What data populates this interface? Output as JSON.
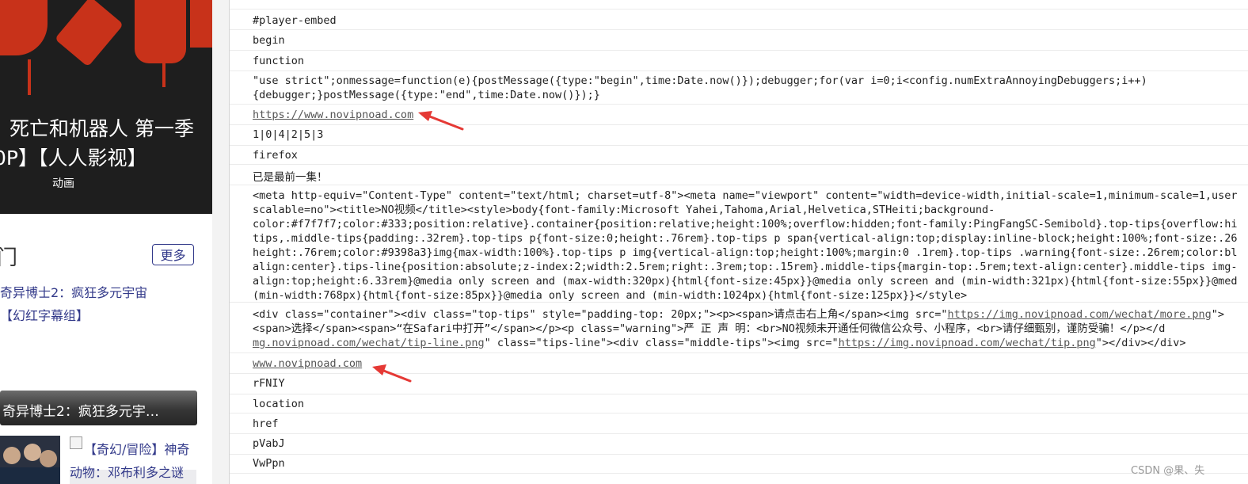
{
  "left_panel": {
    "poster": {
      "title_line1": "死亡和机器人 第一季",
      "title_line2": "0P】【人人影视】",
      "category": "动画"
    },
    "hot_section": {
      "title": "门",
      "more_label": "更多",
      "links": [
        "奇异博士2：疯狂多元宇宙",
        "【幻红字幕组】"
      ]
    },
    "card_label": "奇异博士2：疯狂多元宇…",
    "list_item": {
      "text_line1": "【奇幻/冒险】神奇",
      "text_line2": "动物：邓布利多之谜"
    }
  },
  "strings": {
    "row_00": "#player-embed",
    "row_01": "begin",
    "row_02": "function",
    "row_03_l1": "\"use strict\";onmessage=function(e){postMessage({type:\"begin\",time:Date.now()});debugger;for(var i=0;i<config.numExtraAnnoyingDebuggers;i++)",
    "row_03_l2": "{debugger;}postMessage({type:\"end\",time:Date.now()});}",
    "row_04": "https://www.novipnoad.com",
    "row_05": "1|0|4|2|5|3",
    "row_06": "firefox",
    "row_07": "已是最前一集！",
    "row_08_lines": [
      "<meta http-equiv=\"Content-Type\" content=\"text/html; charset=utf-8\"><meta name=\"viewport\" content=\"width=device-width,initial-scale=1,minimum-scale=1,user",
      "scalable=no\"><title>NO视频</title><style>body{font-family:Microsoft Yahei,Tahoma,Arial,Helvetica,STHeiti;background-",
      "color:#f7f7f7;color:#333;position:relative}.container{position:relative;height:100%;overflow:hidden;font-family:PingFangSC-Semibold}.top-tips{overflow:hi",
      "tips,.middle-tips{padding:.32rem}.top-tips p{font-size:0;height:.76rem}.top-tips p span{vertical-align:top;display:inline-block;height:100%;font-size:.26",
      "height:.76rem;color:#9398a3}img{max-width:100%}.top-tips p img{vertical-align:top;height:100%;margin:0 .1rem}.top-tips .warning{font-size:.26rem;color:bl",
      "align:center}.tips-line{position:absolute;z-index:2;width:2.5rem;right:.3rem;top:.15rem}.middle-tips{margin-top:.5rem;text-align:center}.middle-tips img-",
      "align:top;height:6.33rem}@media only screen and (max-width:320px){html{font-size:45px}}@media only screen and (min-width:321px){html{font-size:55px}}@med",
      "(min-width:768px){html{font-size:85px}}@media only screen and (min-width:1024px){html{font-size:125px}}</style>"
    ],
    "row_09_l1a": "<div class=\"container\"><div class=\"top-tips\" style=\"padding-top: 20px;\"><p><span>请点击右上角</span><img src=\"",
    "row_09_l1link": "https://img.novipnoad.com/wechat/more.png",
    "row_09_l1b": "\">",
    "row_09_l2": "<span>选择</span><span>“在Safari中打开”</span></p><p class=\"warning\">严 正 声 明：<br>NO视频未开通任何微信公众号、小程序，<br>请仔细甄别，谨防受骗！</p></d",
    "row_09_l3link1": "mg.novipnoad.com/wechat/tip-line.png",
    "row_09_l3a": "\" class=\"tips-line\"><div class=\"middle-tips\"><img src=\"",
    "row_09_l3link2": "https://img.novipnoad.com/wechat/tip.png",
    "row_09_l3b": "\"></div></div>",
    "row_10": "www.novipnoad.com",
    "row_11": "rFNIY",
    "row_12": "location",
    "row_13": "href",
    "row_14": "pVabJ",
    "row_15": "VwPpn"
  },
  "watermark": "CSDN @果、失",
  "colors": {
    "arrow": "#e53935",
    "link_blue": "#333a8a",
    "poster_red": "#c8321a"
  }
}
